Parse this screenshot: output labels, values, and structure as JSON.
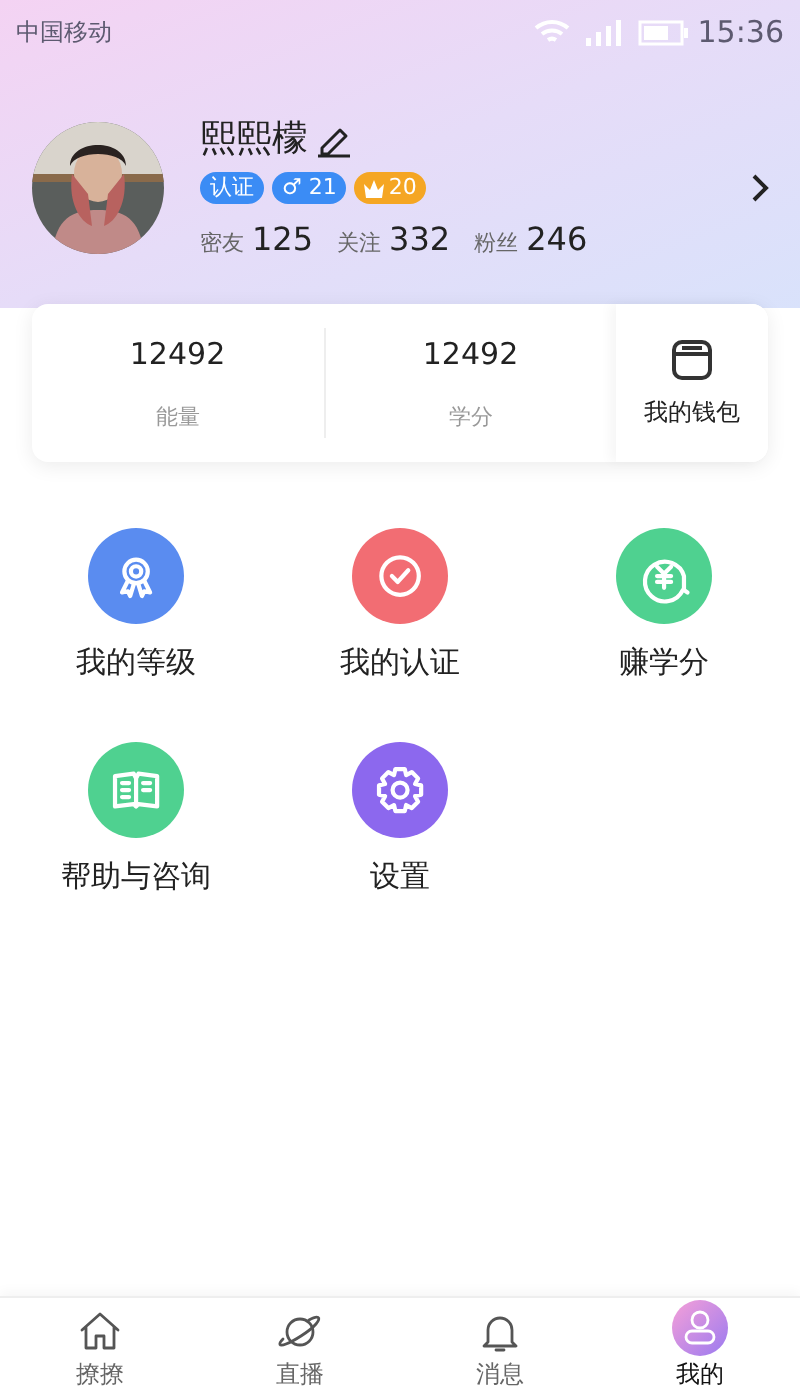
{
  "status_bar": {
    "carrier": "中国移动",
    "time": "15:36"
  },
  "profile": {
    "name": "熙熙檬",
    "badges": [
      {
        "kind": "text",
        "text": "认证",
        "color": "#3b8cf5"
      },
      {
        "kind": "text",
        "text": "♂ 21",
        "color": "#3b8cf5"
      },
      {
        "kind": "crown",
        "text": "20",
        "color": "#f5a623"
      }
    ],
    "stats": [
      {
        "label": "密友",
        "value": "125"
      },
      {
        "label": "关注",
        "value": "332"
      },
      {
        "label": "粉丝",
        "value": "246"
      }
    ]
  },
  "summary": {
    "items": [
      {
        "value": "12492",
        "label": "能量"
      },
      {
        "value": "12492",
        "label": "学分"
      }
    ],
    "wallet": "我的钱包"
  },
  "menu": [
    {
      "label": "我的等级",
      "color": "#5a8cf0"
    },
    {
      "label": "我的认证",
      "color": "#f26d73"
    },
    {
      "label": "赚学分",
      "color": "#4fd190"
    },
    {
      "label": "帮助与咨询",
      "color": "#4fd190"
    },
    {
      "label": "设置",
      "color": "#8c68ee"
    }
  ],
  "tab_bar": [
    {
      "label": "撩撩",
      "selected": false
    },
    {
      "label": "直播",
      "selected": false
    },
    {
      "label": "消息",
      "selected": false
    },
    {
      "label": "我的",
      "selected": true
    }
  ]
}
